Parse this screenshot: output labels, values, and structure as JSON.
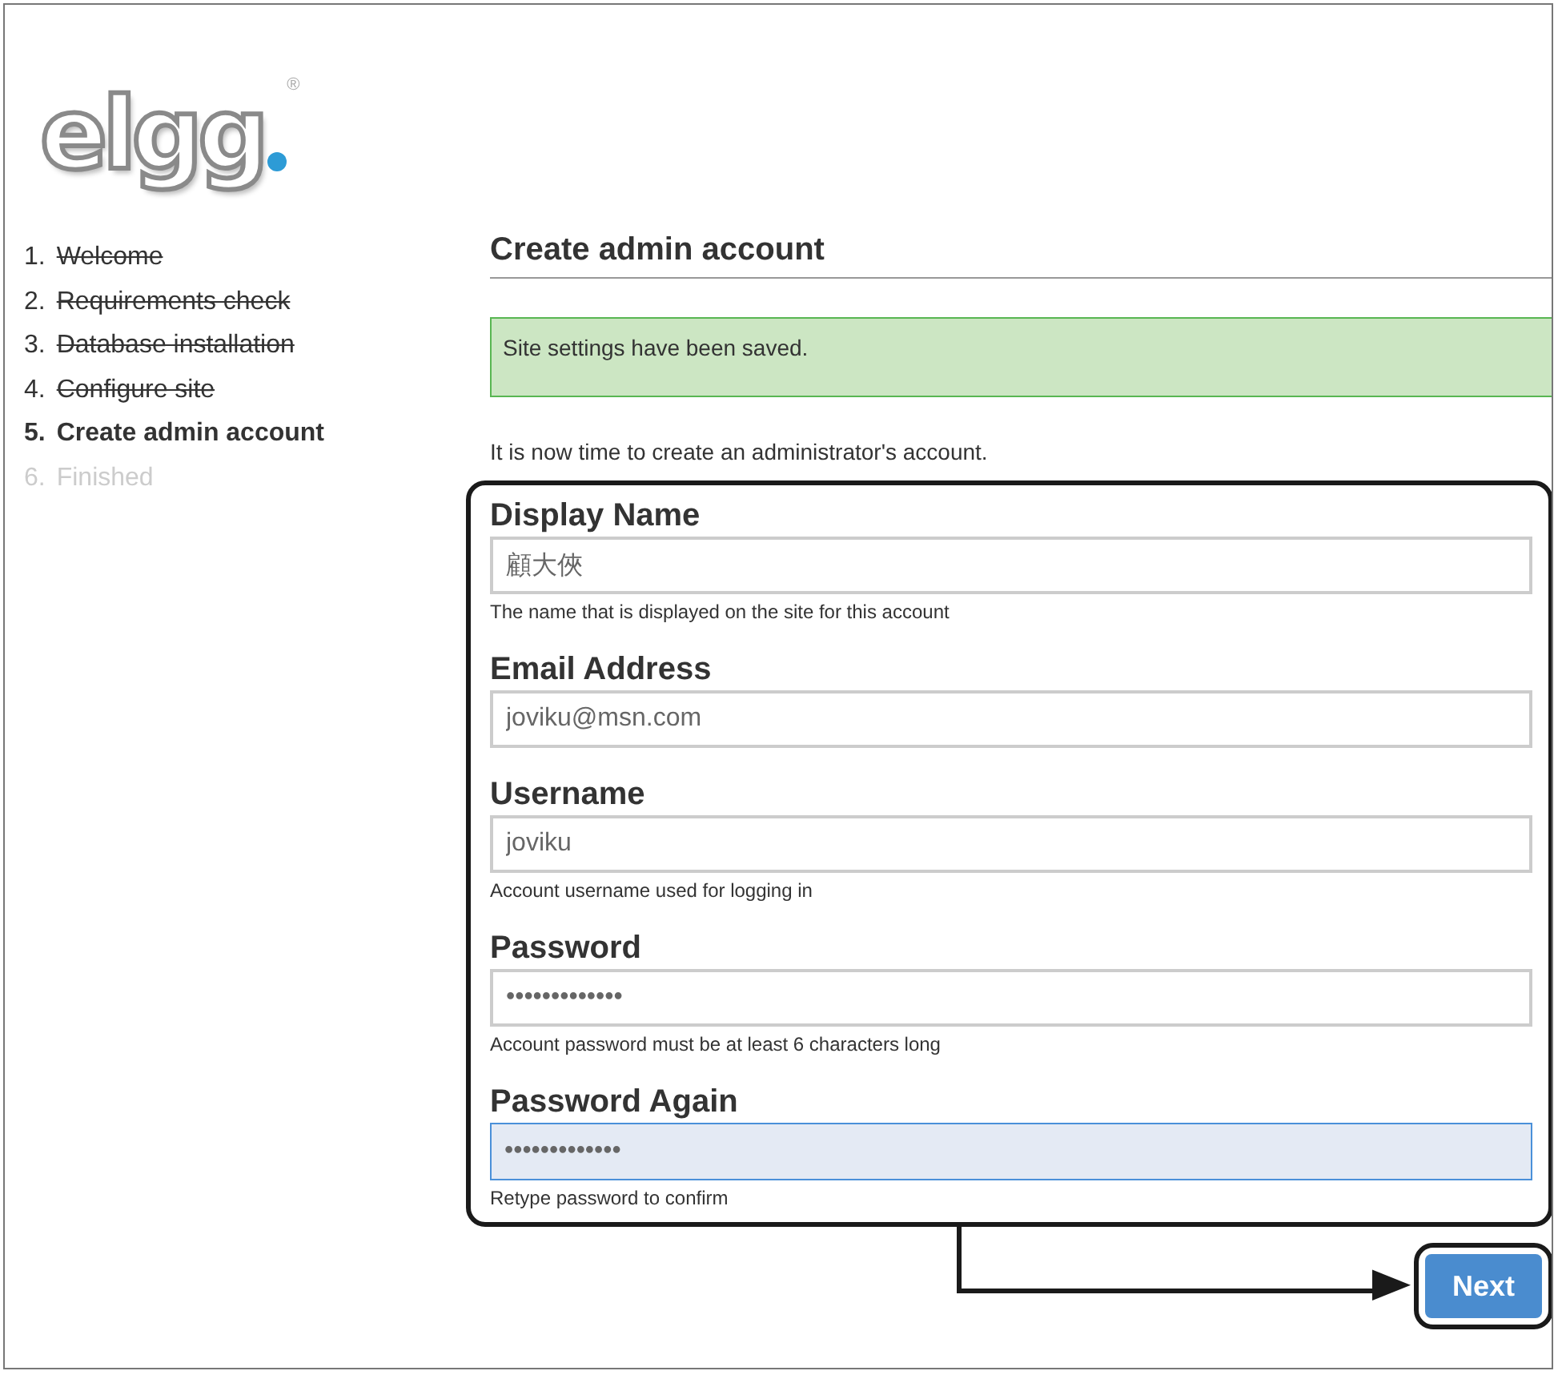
{
  "logo": {
    "text": "elgg",
    "mark": "®"
  },
  "steps": [
    {
      "number": "1.",
      "label": "Welcome",
      "done": true,
      "selected": false
    },
    {
      "number": "2.",
      "label": "Requirements check",
      "done": true,
      "selected": false
    },
    {
      "number": "3.",
      "label": "Database installation",
      "done": true,
      "selected": false
    },
    {
      "number": "4.",
      "label": "Configure site",
      "done": true,
      "selected": false
    },
    {
      "number": "5.",
      "label": "Create admin account",
      "done": false,
      "selected": true
    },
    {
      "number": "6.",
      "label": "Finished",
      "done": false,
      "selected": false
    }
  ],
  "title": "Create admin account",
  "message": {
    "kind": "success",
    "text": "Site settings have been saved."
  },
  "intro": "It is now time to create an administrator's account.",
  "fields": [
    {
      "label": "Display Name",
      "value": "顧大俠",
      "hint": "The name that is displayed on the site for this account",
      "focused": false
    },
    {
      "label": "Email Address",
      "value": "joviku@msn.com",
      "focused": false
    },
    {
      "label": "Username",
      "value": "joviku",
      "hint": "Account username used for logging in",
      "focused": false
    },
    {
      "label": "Password",
      "value": "•••••••••••••",
      "hint": "Account password must be at least 6 characters long",
      "focused": false
    },
    {
      "label": "Password Again",
      "value": "•••••••••••••",
      "hint": "Retype password to confirm",
      "focused": true
    }
  ],
  "button": "Next"
}
